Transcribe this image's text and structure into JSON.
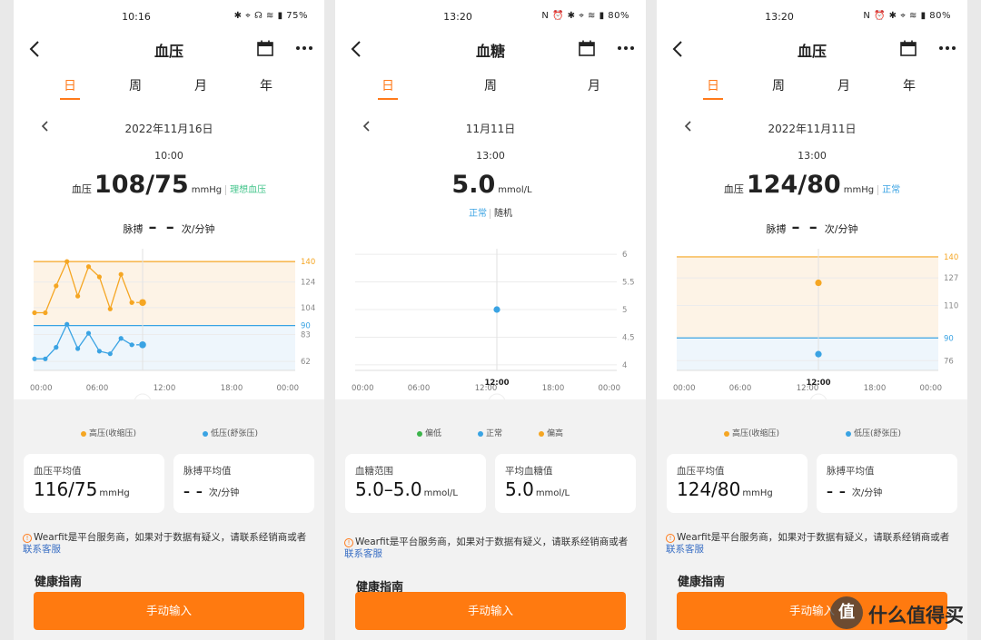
{
  "colors": {
    "accent": "#ff7a1a",
    "systolic": "#f5a623",
    "diastolic": "#3aa3e3",
    "normal_green": "#45c58c",
    "low": "#3cb44b"
  },
  "screens": [
    {
      "status": {
        "time": "10:16",
        "icons": "✱ ⌖ ☊ ≋ ▮ 75%"
      },
      "title": "血压",
      "tabs": [
        "日",
        "周",
        "月",
        "年"
      ],
      "active_tab": "日",
      "date": "2022年11月16日",
      "time": "10:00",
      "reading": {
        "prefix": "血压",
        "value": "108/75",
        "unit": "mmHg",
        "status": "理想血压"
      },
      "pulse": {
        "label": "脉搏",
        "value": "– –",
        "unit": "次/分钟"
      },
      "legend": [
        {
          "label": "高压(收缩压)",
          "color": "#f5a623"
        },
        {
          "label": "低压(舒张压)",
          "color": "#3aa3e3"
        }
      ],
      "cards": [
        {
          "label": "血压平均值",
          "value": "116/75",
          "unit": "mmHg"
        },
        {
          "label": "脉搏平均值",
          "value": "– –",
          "unit": "次/分钟"
        }
      ],
      "notice": {
        "text": "Wearfit是平台服务商，如果对于数据有疑义，请联系经销商或者",
        "link": "联系客服"
      },
      "guide": "健康指南",
      "button": "手动输入"
    },
    {
      "status": {
        "time": "13:20",
        "icons": "N ⏰ ✱ ⌖ ≋ ▮ 80%"
      },
      "title": "血糖",
      "tabs": [
        "日",
        "周",
        "月"
      ],
      "active_tab": "日",
      "date": "11月11日",
      "time": "13:00",
      "reading": {
        "value": "5.0",
        "unit": "mmol/L",
        "status": "正常",
        "status2": "随机"
      },
      "legend": [
        {
          "label": "偏低",
          "color": "#3cb44b"
        },
        {
          "label": "正常",
          "color": "#3aa3e3"
        },
        {
          "label": "偏高",
          "color": "#f5a623"
        }
      ],
      "cards": [
        {
          "label": "血糖范围",
          "value": "5.0–5.0",
          "unit": "mmol/L"
        },
        {
          "label": "平均血糖值",
          "value": "5.0",
          "unit": "mmol/L"
        }
      ],
      "notice": {
        "text": "Wearfit是平台服务商，如果对于数据有疑义，请联系经销商或者",
        "link": "联系客服"
      },
      "guide": "健康指南",
      "button": "手动输入"
    },
    {
      "status": {
        "time": "13:20",
        "icons": "N ⏰ ✱ ⌖ ≋ ▮ 80%"
      },
      "title": "血压",
      "tabs": [
        "日",
        "周",
        "月",
        "年"
      ],
      "active_tab": "日",
      "date": "2022年11月11日",
      "time": "13:00",
      "reading": {
        "prefix": "血压",
        "value": "124/80",
        "unit": "mmHg",
        "status": "正常"
      },
      "pulse": {
        "label": "脉搏",
        "value": "– –",
        "unit": "次/分钟"
      },
      "legend": [
        {
          "label": "高压(收缩压)",
          "color": "#f5a623"
        },
        {
          "label": "低压(舒张压)",
          "color": "#3aa3e3"
        }
      ],
      "cards": [
        {
          "label": "血压平均值",
          "value": "124/80",
          "unit": "mmHg"
        },
        {
          "label": "脉搏平均值",
          "value": "– –",
          "unit": "次/分钟"
        }
      ],
      "notice": {
        "text": "Wearfit是平台服务商，如果对于数据有疑义，请联系经销商或者",
        "link": "联系客服"
      },
      "guide": "健康指南",
      "button": "手动输入"
    }
  ],
  "chart_data": [
    {
      "type": "line",
      "x_ticks": [
        "00:00",
        "06:00",
        "12:00",
        "18:00",
        "00:00"
      ],
      "y_ticks": [
        140,
        124,
        104,
        90,
        83,
        62
      ],
      "ylim": [
        55,
        150
      ],
      "reference_lines": [
        140,
        90
      ],
      "series": [
        {
          "name": "高压(收缩压)",
          "x_hours": [
            0.0,
            1.0,
            2.0,
            3.0,
            4.0,
            5.0,
            6.0,
            7.0,
            8.0,
            9.0,
            10.0
          ],
          "values": [
            100,
            100,
            121,
            140,
            113,
            136,
            128,
            103,
            130,
            108,
            108
          ]
        },
        {
          "name": "低压(舒张压)",
          "x_hours": [
            0.0,
            1.0,
            2.0,
            3.0,
            4.0,
            5.0,
            6.0,
            7.0,
            8.0,
            9.0,
            10.0
          ],
          "values": [
            64,
            64,
            73,
            91,
            72,
            84,
            70,
            68,
            80,
            75,
            75
          ]
        }
      ]
    },
    {
      "type": "scatter",
      "x_ticks": [
        "00:00",
        "06:00",
        "12:00",
        "18:00",
        "00:00"
      ],
      "y_ticks": [
        6.0,
        5.5,
        5.0,
        4.5,
        4.0
      ],
      "ylim": [
        3.9,
        6.1
      ],
      "series": [
        {
          "name": "正常",
          "x_hours": [
            13.0
          ],
          "values": [
            5.0
          ]
        }
      ]
    },
    {
      "type": "scatter",
      "x_ticks": [
        "00:00",
        "06:00",
        "12:00",
        "18:00",
        "00:00"
      ],
      "y_ticks": [
        140,
        127,
        110,
        90,
        76
      ],
      "ylim": [
        70,
        145
      ],
      "reference_lines": [
        140,
        90
      ],
      "series": [
        {
          "name": "高压(收缩压)",
          "x_hours": [
            13.0
          ],
          "values": [
            124
          ]
        },
        {
          "name": "低压(舒张压)",
          "x_hours": [
            13.0
          ],
          "values": [
            80
          ]
        }
      ]
    }
  ]
}
